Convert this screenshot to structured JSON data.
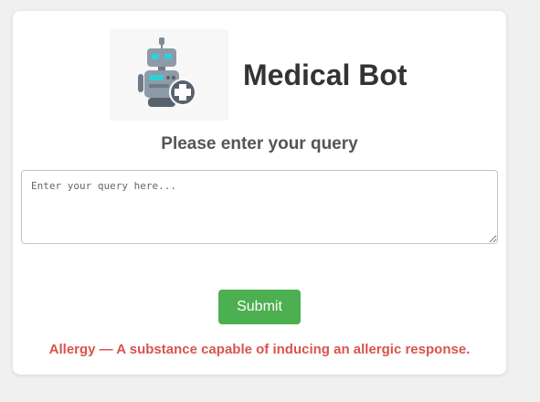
{
  "app": {
    "title": "Medical Bot",
    "logo_icon": "medical-robot-icon"
  },
  "query": {
    "label": "Please enter your query",
    "placeholder": "Enter your query here...",
    "value": ""
  },
  "actions": {
    "submit_label": "Submit"
  },
  "response": {
    "text": "Allergy — A substance capable of inducing an allergic response."
  },
  "colors": {
    "page_background": "#f0f0f0",
    "card_background": "#ffffff",
    "title": "#333333",
    "submit_button": "#4caf50",
    "response_text": "#d9534f"
  }
}
